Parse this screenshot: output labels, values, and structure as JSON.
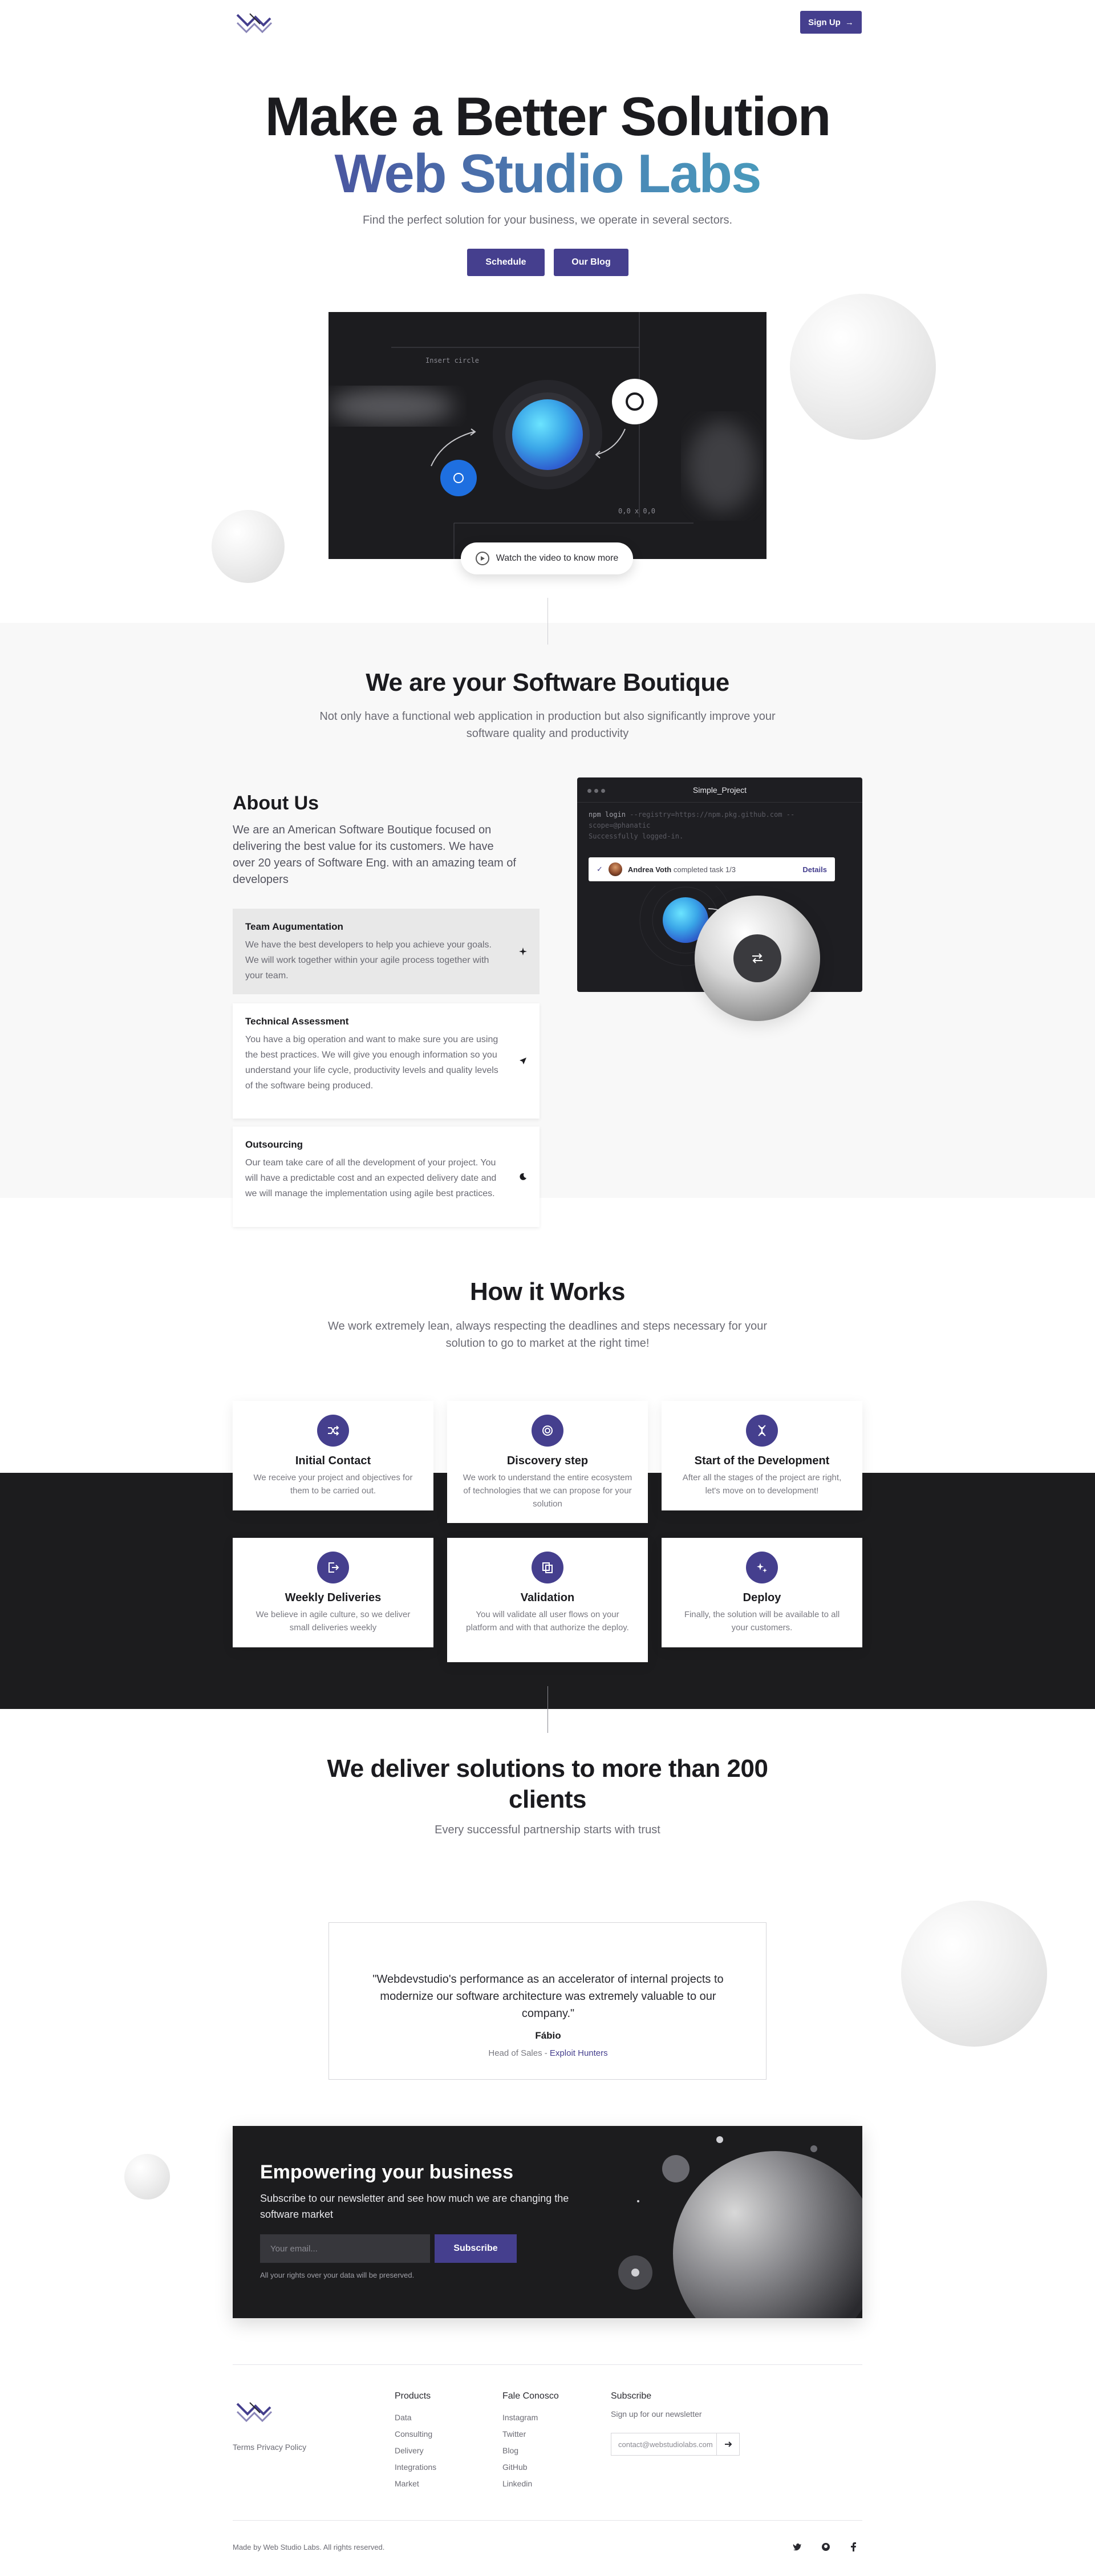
{
  "header": {
    "signup_label": "Sign Up",
    "signup_arrow": "→"
  },
  "hero": {
    "title_line1": "Make a Better Solution",
    "title_line2": "Web Studio Labs",
    "subtitle": "Find the perfect solution for your business, we operate in several sectors.",
    "schedule_label": "Schedule",
    "blog_label": "Our Blog",
    "video": {
      "label_top": "Insert circle",
      "label_bottom": "0,0 x 0,0",
      "watch_label": "Watch the video to know more"
    }
  },
  "boutique": {
    "title": "We are your Software Boutique",
    "subtitle": "Not only have a functional web application in production but also significantly improve your software quality and productivity",
    "about_title": "About Us",
    "about_text": "We are an American Software Boutique focused on delivering the best value for its customers. We have over 20 years of Software Eng. with an amazing team of developers",
    "cards": [
      {
        "title": "Team Augumentation",
        "text": "We have the best developers to help you achieve your goals. We will work together within your agile process together with your team."
      },
      {
        "title": "Technical Assessment",
        "text": "You have a big operation and want to make sure you are using the best practices. We will give you enough information so you understand your life cycle, productivity levels and quality levels of the software being produced."
      },
      {
        "title": "Outsourcing",
        "text": "Our team take care of all the development of your project. You will have a predictable cost and an expected delivery date and we will manage the implementation using agile best practices."
      }
    ],
    "mock": {
      "title": "Simple_Project",
      "code_cmd": "npm login",
      "code_args": " --registry=https://npm.pkg.github.com --",
      "code_line2": "scope=@phanatic",
      "code_line3": "Successfully logged-in.",
      "notif_name": "Andrea Voth",
      "notif_text": " completed task 1/3",
      "notif_link": "Details"
    }
  },
  "how": {
    "title": "How it Works",
    "subtitle": "We work extremely lean, always respecting the deadlines and steps necessary for your solution to go to market at the right time!",
    "steps": [
      {
        "title": "Initial Contact",
        "text": "We receive your project and objectives for them to be carried out.",
        "icon": "shuffle-icon"
      },
      {
        "title": "Discovery step",
        "text": "We work to understand the entire ecosystem of technologies that we can propose for your solution",
        "icon": "fingerprint-icon"
      },
      {
        "title": "Start of the Development",
        "text": "After all the stages of the project are right, let's move on to development!",
        "icon": "dna-icon"
      },
      {
        "title": "Weekly Deliveries",
        "text": "We believe in agile culture, so we deliver small deliveries weekly",
        "icon": "export-icon"
      },
      {
        "title": "Validation",
        "text": "You will validate all user flows on your platform and with that authorize the deploy.",
        "icon": "copy-icon"
      },
      {
        "title": "Deploy",
        "text": "Finally, the solution will be available to all your customers.",
        "icon": "sparkles-icon"
      }
    ]
  },
  "clients": {
    "title_line1": "We deliver solutions to more than 200",
    "title_line2": "clients",
    "subtitle": "Every successful partnership starts with trust",
    "quote": "\"Webdevstudio's performance as an accelerator of internal projects to modernize our software architecture was extremely valuable to our company.\"",
    "author": "Fábio",
    "role": "Head of Sales - ",
    "company": "Exploit Hunters"
  },
  "newsletter": {
    "title": "Empowering your business",
    "text": "Subscribe to our newsletter and see how much we are changing the software market",
    "email_placeholder": "Your email...",
    "subscribe_label": "Subscribe",
    "rights": "All your rights over your data will be preserved."
  },
  "footer": {
    "legal": "Terms  Privacy Policy",
    "products_title": "Products",
    "products": [
      "Data",
      "Consulting",
      "Delivery",
      "Integrations",
      "Market"
    ],
    "contact_title": "Fale Conosco",
    "contact": [
      "Instagram",
      "Twitter",
      "Blog",
      "GitHub",
      "Linkedin"
    ],
    "subscribe_title": "Subscribe",
    "subscribe_text": "Sign up for our newsletter",
    "subscribe_placeholder": "contact@webstudiolabs.com",
    "made_by": "Made by Web Studio Labs. All rights reserved."
  },
  "colors": {
    "primary": "#453f8e",
    "dark": "#1c1c1e",
    "light_band": "#f8f8f8"
  }
}
